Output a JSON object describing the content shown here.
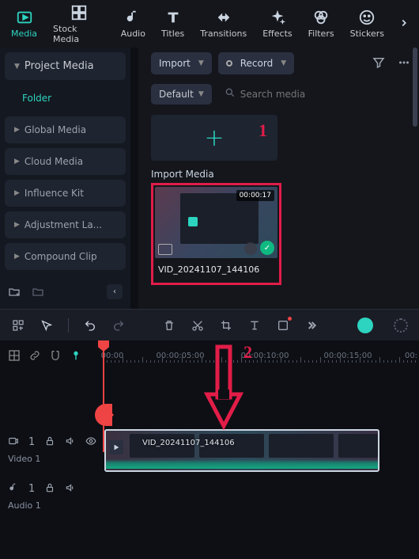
{
  "top_tabs": {
    "media": "Media",
    "stock_media": "Stock Media",
    "audio": "Audio",
    "titles": "Titles",
    "transitions": "Transitions",
    "effects": "Effects",
    "filters": "Filters",
    "stickers": "Stickers"
  },
  "sidebar": {
    "header": "Project Media",
    "sub": "Folder",
    "items": [
      "Global Media",
      "Cloud Media",
      "Influence Kit",
      "Adjustment La...",
      "Compound Clip"
    ]
  },
  "content": {
    "import_btn": "Import",
    "record_btn": "Record",
    "default_btn": "Default",
    "search_placeholder": "Search media",
    "import_tile_label": "Import Media",
    "media_duration": "00:00:17",
    "media_name": "VID_20241107_144106"
  },
  "annotations": {
    "one": "1",
    "two": "2"
  },
  "timeline": {
    "ticks": [
      "00:00",
      "00:00:05:00",
      "00:00:10:00",
      "00:00:15:00",
      "00:"
    ],
    "clip_title": "VID_20241107_144106",
    "track_video": "Video 1",
    "track_audio": "Audio 1",
    "vcount": "1",
    "acount": "1"
  }
}
